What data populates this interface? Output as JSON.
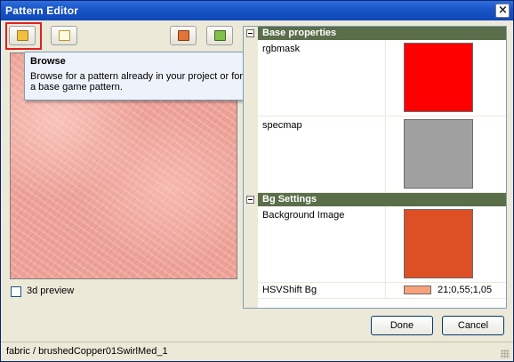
{
  "window": {
    "title": "Pattern Editor"
  },
  "toolbar": {
    "browse_icon_color": "#f0c040",
    "new_icon_color": "#f6e27a",
    "tool3_icon_color": "#e0743a",
    "tool4_icon_color": "#7fbf4a"
  },
  "tooltip": {
    "title": "Browse",
    "body": "Browse for a pattern already in your project or for a base game pattern."
  },
  "preview": {
    "checkbox_label": "3d preview",
    "checked": false
  },
  "grid": {
    "categories": [
      {
        "label": "Base properties",
        "props": [
          {
            "name": "rgbmask",
            "color": "#ff0000"
          },
          {
            "name": "specmap",
            "color": "#a0a0a0"
          }
        ]
      },
      {
        "label": "Bg Settings",
        "props": [
          {
            "name": "Background Image",
            "color": "#dd4f24"
          },
          {
            "name": "HSVShift Bg",
            "color": "#f7a27a",
            "value": "21;0,55;1,05"
          }
        ]
      }
    ]
  },
  "buttons": {
    "done": "Done",
    "cancel": "Cancel"
  },
  "status": {
    "path": "fabric / brushedCopper01SwirlMed_1"
  }
}
